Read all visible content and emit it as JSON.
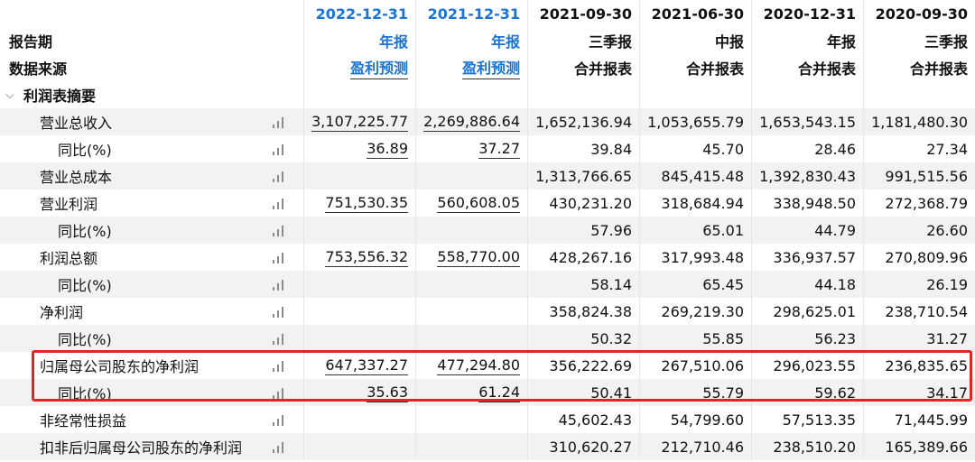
{
  "header": {
    "rows": [
      {
        "label": "",
        "values": [
          "2022-12-31",
          "2021-12-31",
          "2021-09-30",
          "2021-06-30",
          "2020-12-31",
          "2020-09-30"
        ]
      },
      {
        "label": "报告期",
        "values": [
          "年报",
          "年报",
          "三季报",
          "中报",
          "年报",
          "三季报"
        ]
      },
      {
        "label": "数据来源",
        "values": [
          "盈利预测",
          "盈利预测",
          "合并报表",
          "合并报表",
          "合并报表",
          "合并报表"
        ]
      }
    ],
    "forecast_color": "#1a73d6"
  },
  "section": {
    "title": "利润表摘要",
    "icon": "chevron-down-icon"
  },
  "rows": [
    {
      "label": "营业总收入",
      "values": [
        "3,107,225.77",
        "2,269,886.64",
        "1,652,136.94",
        "1,053,655.79",
        "1,653,543.15",
        "1,181,480.30"
      ]
    },
    {
      "label": "同比(%)",
      "values": [
        "36.89",
        "37.27",
        "39.84",
        "45.70",
        "28.46",
        "27.34"
      ]
    },
    {
      "label": "营业总成本",
      "values": [
        "",
        "",
        "1,313,766.65",
        "845,415.48",
        "1,392,830.43",
        "991,515.56"
      ]
    },
    {
      "label": "营业利润",
      "values": [
        "751,530.35",
        "560,608.05",
        "430,231.20",
        "318,684.94",
        "338,948.50",
        "272,368.79"
      ]
    },
    {
      "label": "同比(%)",
      "values": [
        "",
        "",
        "57.96",
        "65.01",
        "44.79",
        "26.60"
      ]
    },
    {
      "label": "利润总额",
      "values": [
        "753,556.32",
        "558,770.00",
        "428,267.16",
        "317,993.48",
        "336,937.57",
        "270,809.96"
      ]
    },
    {
      "label": "同比(%)",
      "values": [
        "",
        "",
        "58.14",
        "65.45",
        "44.18",
        "26.19"
      ]
    },
    {
      "label": "净利润",
      "values": [
        "",
        "",
        "358,824.38",
        "269,219.30",
        "298,625.01",
        "238,710.54"
      ]
    },
    {
      "label": "同比(%)",
      "values": [
        "",
        "",
        "50.32",
        "55.85",
        "56.23",
        "31.27"
      ]
    },
    {
      "label": "归属母公司股东的净利润",
      "values": [
        "647,337.27",
        "477,294.80",
        "356,222.69",
        "267,510.06",
        "296,023.55",
        "236,835.65"
      ]
    },
    {
      "label": "同比(%)",
      "values": [
        "35.63",
        "61.24",
        "50.41",
        "55.79",
        "59.62",
        "34.17"
      ]
    },
    {
      "label": "非经常性损益",
      "values": [
        "",
        "",
        "45,602.43",
        "54,799.60",
        "57,513.35",
        "71,445.99"
      ]
    },
    {
      "label": "扣非后归属母公司股东的净利润",
      "values": [
        "",
        "",
        "310,620.27",
        "212,710.46",
        "238,510.20",
        "165,389.66"
      ]
    }
  ],
  "highlight_color": "#e32424"
}
